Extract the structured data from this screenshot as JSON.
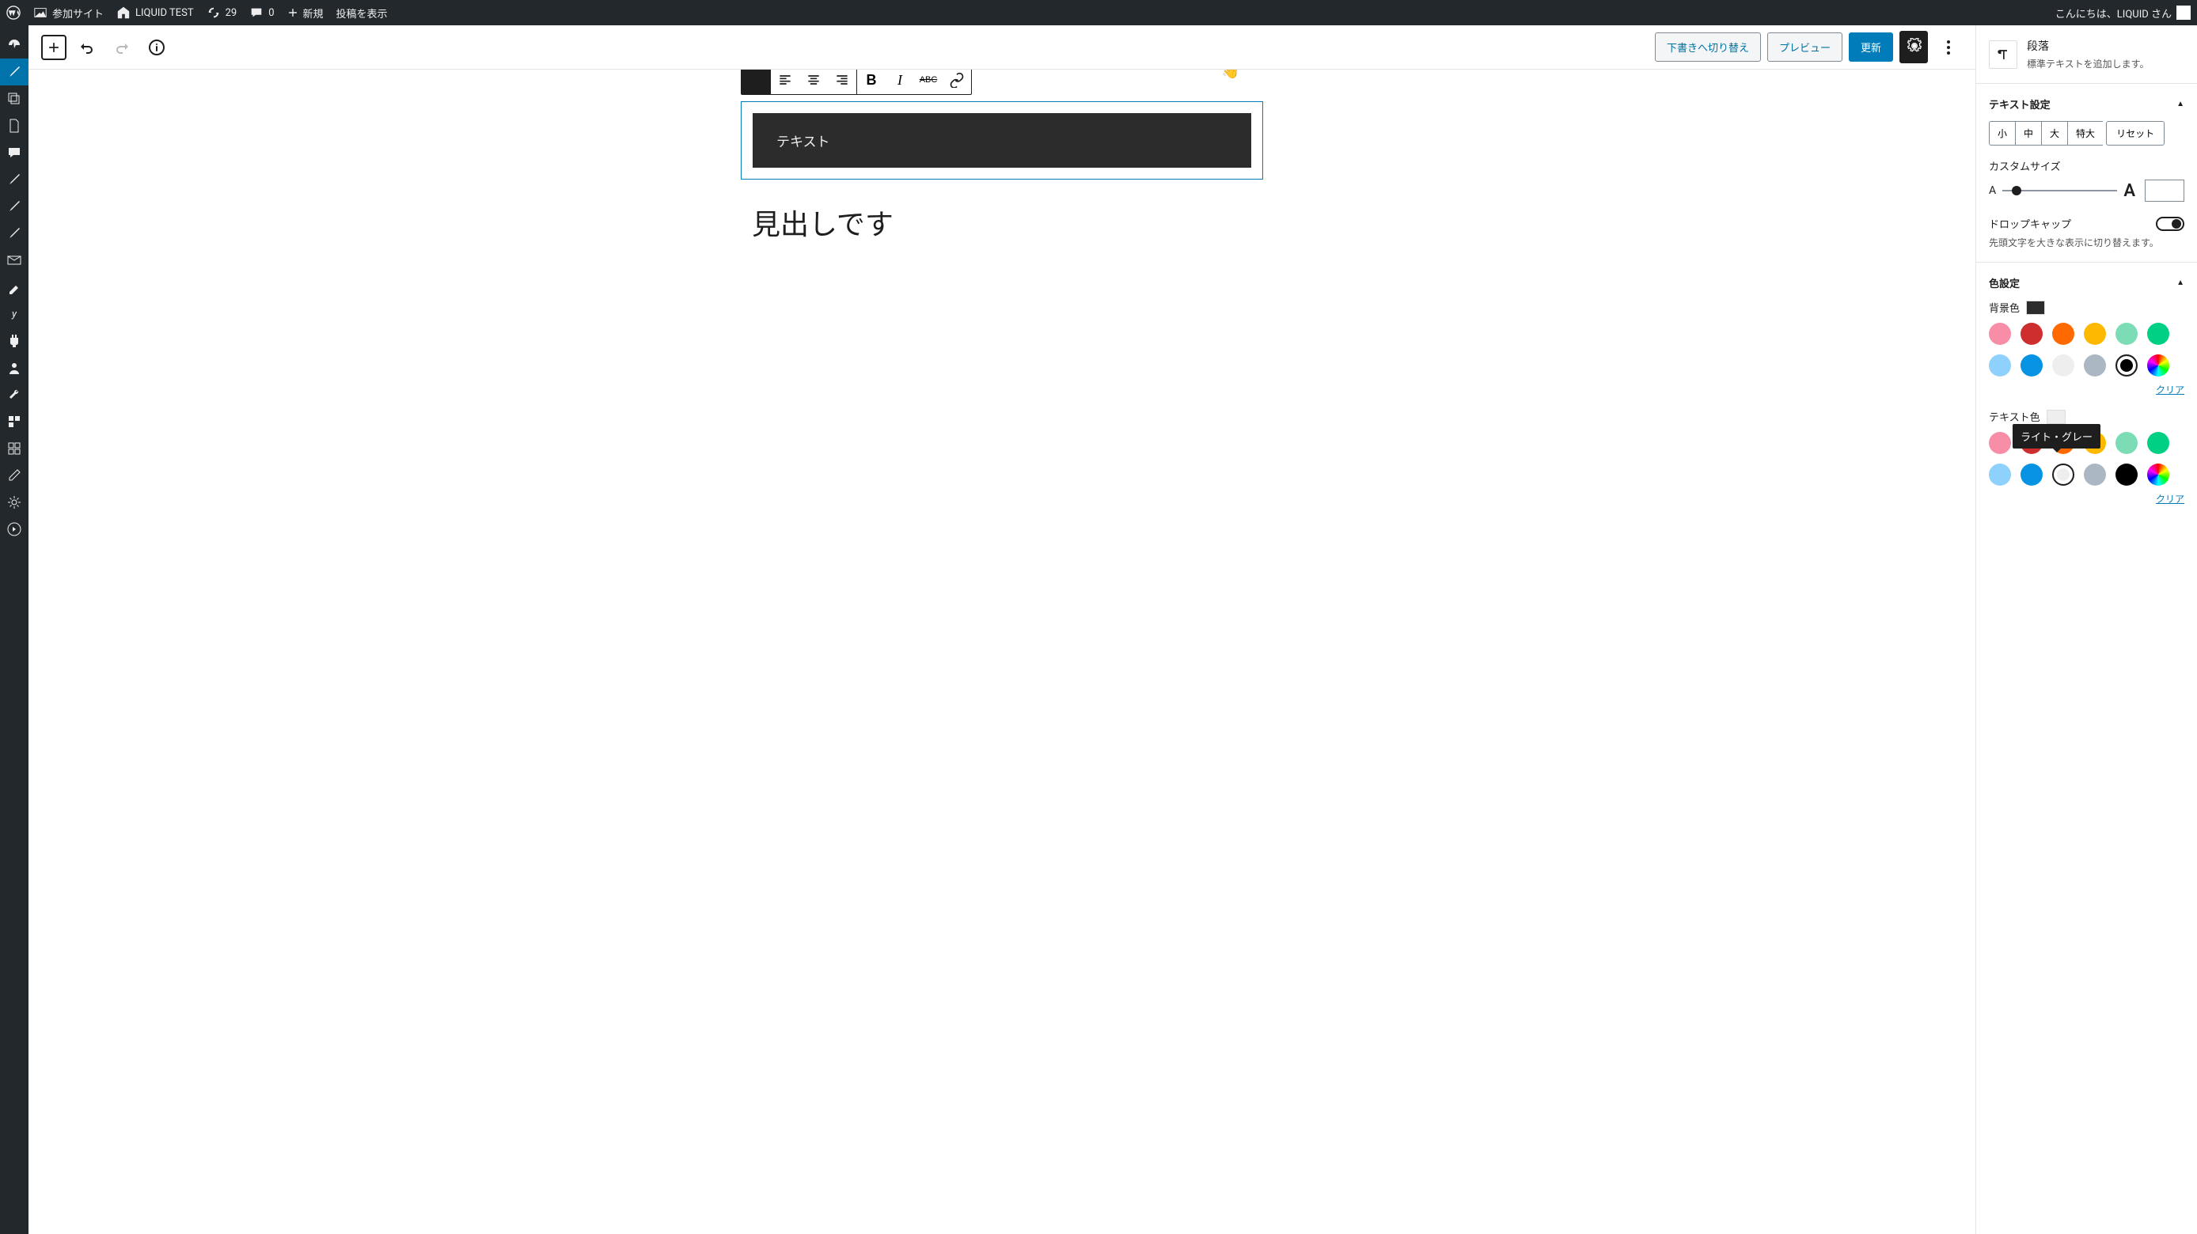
{
  "adminBar": {
    "mySites": "参加サイト",
    "siteName": "LIQUID TEST",
    "updates": "29",
    "comments": "0",
    "new": "新規",
    "viewPost": "投稿を表示",
    "greeting": "こんにちは、LIQUID さん"
  },
  "editorHeader": {
    "switchDraft": "下書きへ切り替え",
    "preview": "プレビュー",
    "update": "更新"
  },
  "content": {
    "blockText": "テキスト",
    "heading": "見出しです"
  },
  "rightPanel": {
    "blockType": "段落",
    "blockDesc": "標準テキストを追加します。",
    "textSettings": "テキスト設定",
    "sizes": {
      "small": "小",
      "medium": "中",
      "large": "大",
      "xlarge": "特大",
      "reset": "リセット"
    },
    "customSize": "カスタムサイズ",
    "dropCap": "ドロップキャップ",
    "dropCapDesc": "先頭文字を大きな表示に切り替えます。",
    "colorSettings": "色設定",
    "backgroundColor": "背景色",
    "textColor": "テキスト色",
    "clear": "クリア",
    "tooltip": "ライト・グレー",
    "bgPreview": "#2c2c2c",
    "textPreview": "#eeeeee",
    "colors": {
      "row1": [
        "#f78da7",
        "#cf2e2e",
        "#ff6900",
        "#fcb900",
        "#7bdcb5",
        "#00d084"
      ],
      "row2": [
        "#8ed1fc",
        "#0693e3",
        "#eeeeee",
        "#abb8c3",
        "#000000"
      ]
    }
  }
}
